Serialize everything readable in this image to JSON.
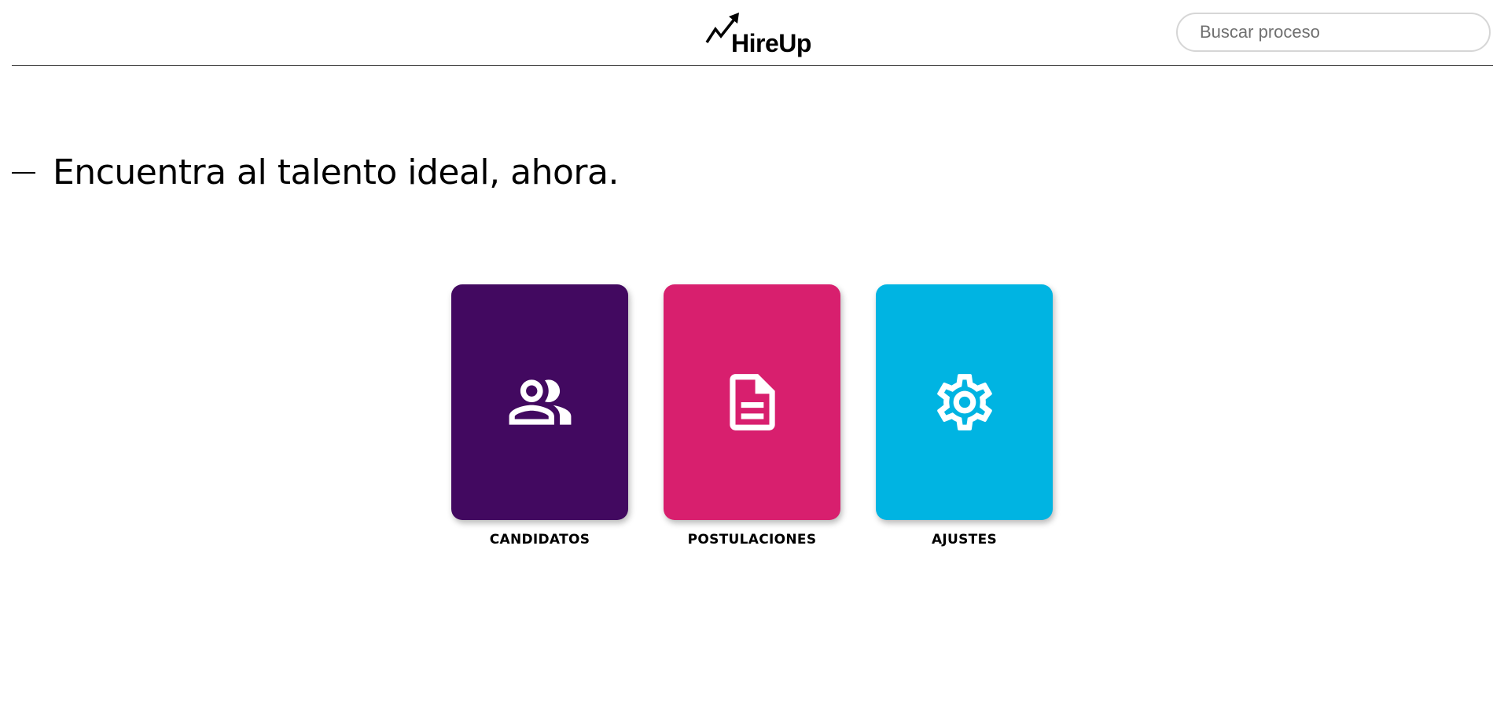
{
  "header": {
    "logo_text": "HireUp",
    "search": {
      "placeholder": "Buscar proceso",
      "value": ""
    }
  },
  "hero": {
    "title": "Encuentra al talento ideal, ahora."
  },
  "cards": [
    {
      "label": "CANDIDATOS",
      "icon": "people-icon",
      "color": "#420960"
    },
    {
      "label": "POSTULACIONES",
      "icon": "document-icon",
      "color": "#D81F6E"
    },
    {
      "label": "AJUSTES",
      "icon": "gear-icon",
      "color": "#00B4E2"
    }
  ]
}
